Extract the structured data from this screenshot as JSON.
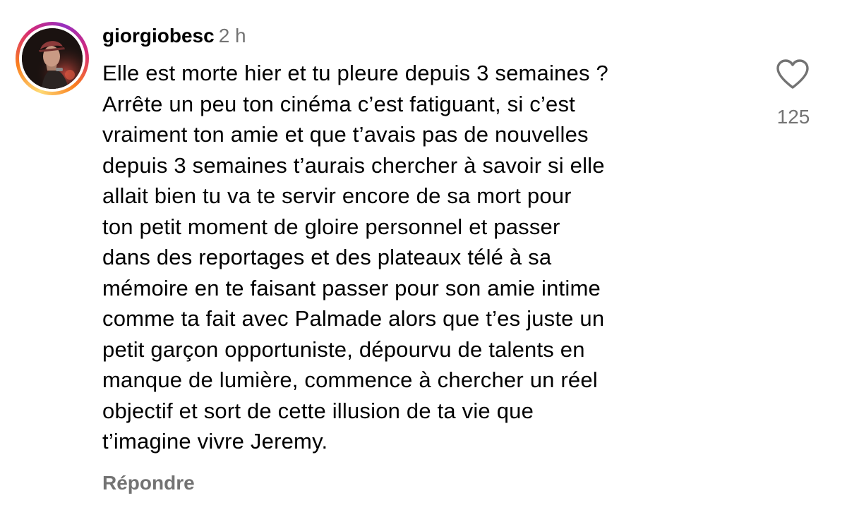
{
  "comment": {
    "username": "giorgiobesc",
    "time": "2 h",
    "avatar_icon": "user-avatar-photo",
    "text_lines": [
      "Elle est morte hier et tu pleure depuis 3 semaines ?",
      "Arrête un peu ton cinéma c’est fatiguant, si c’est",
      "vraiment ton amie et que t’avais pas de nouvelles",
      "depuis 3 semaines t’aurais chercher à savoir si elle",
      "allait bien tu va te servir encore de sa mort pour",
      "ton petit moment de gloire personnel et passer",
      "dans des reportages et des plateaux télé à sa",
      "mémoire en te faisant passer pour son amie intime",
      "comme ta fait avec Palmade alors que t’es juste un",
      "petit garçon opportuniste, dépourvu de talents en",
      "manque de lumière, commence à chercher un réel",
      "objectif et sort de cette illusion de ta vie que",
      "t’imagine vivre Jeremy."
    ],
    "like_icon": "heart-outline-icon",
    "like_count": "125",
    "reply_label": "Répondre"
  },
  "colors": {
    "text": "#000000",
    "secondary": "#737373",
    "background": "#ffffff",
    "story_ring": [
      "#feda75",
      "#fa7e1e",
      "#d62976",
      "#962fbf"
    ]
  }
}
